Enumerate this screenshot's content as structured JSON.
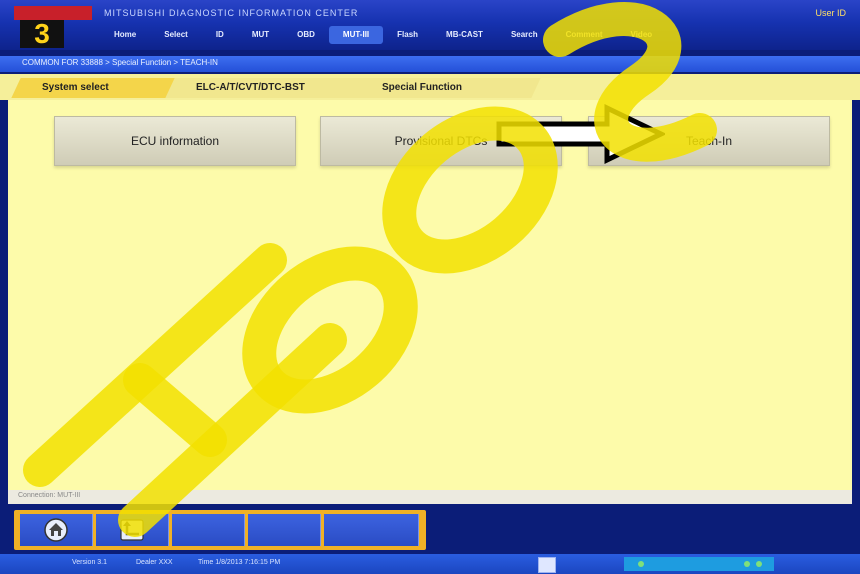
{
  "app": {
    "title": "MITSUBISHI DIAGNOSTIC INFORMATION CENTER",
    "user_id_label": "User ID",
    "logo_glyph": "3"
  },
  "nav": {
    "items": [
      "Home",
      "Select",
      "ID",
      "MUT",
      "OBD",
      "MUT-III",
      "Flash",
      "MB-CAST",
      "Search",
      "Comment",
      "Video"
    ],
    "active_index": 5
  },
  "breadcrumb": {
    "text": "COMMON FOR 33888 > Special Function > TEACH-IN"
  },
  "tabs": [
    "System select",
    "ELC-A/T/CVT/DTC-BST",
    "Special Function"
  ],
  "functions": {
    "ecu_info": "ECU information",
    "provisional_dtcs": "Provisional DTCs",
    "teach_in": "Teach-In"
  },
  "status": {
    "text": "Connection: MUT-III"
  },
  "taskbar": {
    "version": "Version 3.1",
    "dealer": "Dealer XXX",
    "time": "Time 1/8/2013 7:16:15 PM"
  },
  "watermark": {
    "text": "HOOS",
    "color": "#f2e100"
  },
  "colors": {
    "accent_blue": "#1632b0",
    "panel_yellow": "#fdfbaa",
    "tab_active": "#f4d54a",
    "toolbar_orange": "#f0b126"
  },
  "icons": {
    "home": "home-icon",
    "back": "back-icon",
    "arrow": "right-arrow-icon"
  }
}
